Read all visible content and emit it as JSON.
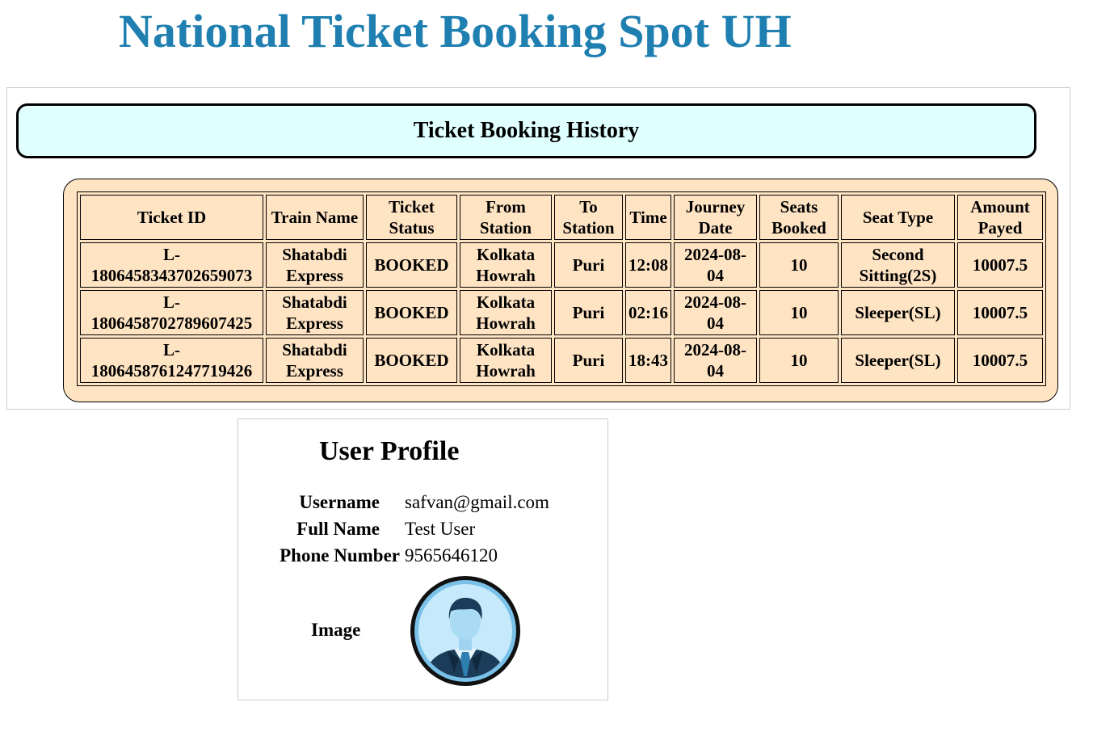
{
  "site": {
    "title": "National Ticket Booking Spot UH"
  },
  "history": {
    "heading": "Ticket Booking History",
    "columns": [
      [
        "Ticket ID"
      ],
      [
        "Train Name"
      ],
      [
        "Ticket",
        "Status"
      ],
      [
        "From",
        "Station"
      ],
      [
        "To",
        "Station"
      ],
      [
        "Time"
      ],
      [
        "Journey",
        "Date"
      ],
      [
        "Seats",
        "Booked"
      ],
      [
        "Seat Type"
      ],
      [
        "Amount",
        "Payed"
      ]
    ],
    "rows": [
      {
        "ticket_id": [
          "L-",
          "1806458343702659073"
        ],
        "train_name": [
          "Shatabdi",
          "Express"
        ],
        "status": "BOOKED",
        "from": [
          "Kolkata",
          "Howrah"
        ],
        "to": "Puri",
        "time": "12:08",
        "date": [
          "2024-08-",
          "04"
        ],
        "seats": "10",
        "seat_type": [
          "Second",
          "Sitting(2S)"
        ],
        "amount": "10007.5"
      },
      {
        "ticket_id": [
          "L-",
          "1806458702789607425"
        ],
        "train_name": [
          "Shatabdi",
          "Express"
        ],
        "status": "BOOKED",
        "from": [
          "Kolkata",
          "Howrah"
        ],
        "to": "Puri",
        "time": "02:16",
        "date": [
          "2024-08-",
          "04"
        ],
        "seats": "10",
        "seat_type": [
          "Sleeper(SL)"
        ],
        "amount": "10007.5"
      },
      {
        "ticket_id": [
          "L-",
          "1806458761247719426"
        ],
        "train_name": [
          "Shatabdi",
          "Express"
        ],
        "status": "BOOKED",
        "from": [
          "Kolkata",
          "Howrah"
        ],
        "to": "Puri",
        "time": "18:43",
        "date": [
          "2024-08-",
          "04"
        ],
        "seats": "10",
        "seat_type": [
          "Sleeper(SL)"
        ],
        "amount": "10007.5"
      }
    ]
  },
  "profile": {
    "title": "User Profile",
    "username_label": "Username",
    "username_value": "safvan@gmail.com",
    "fullname_label": "Full Name",
    "fullname_value": "Test User",
    "phone_label": "Phone Number",
    "phone_value": "9565646120",
    "image_label": "Image",
    "avatar_icon": "user-avatar-icon"
  },
  "colors": {
    "title": "#1e7fb0",
    "header_bg": "#e0ffff",
    "table_bg": "#ffe4c4"
  }
}
